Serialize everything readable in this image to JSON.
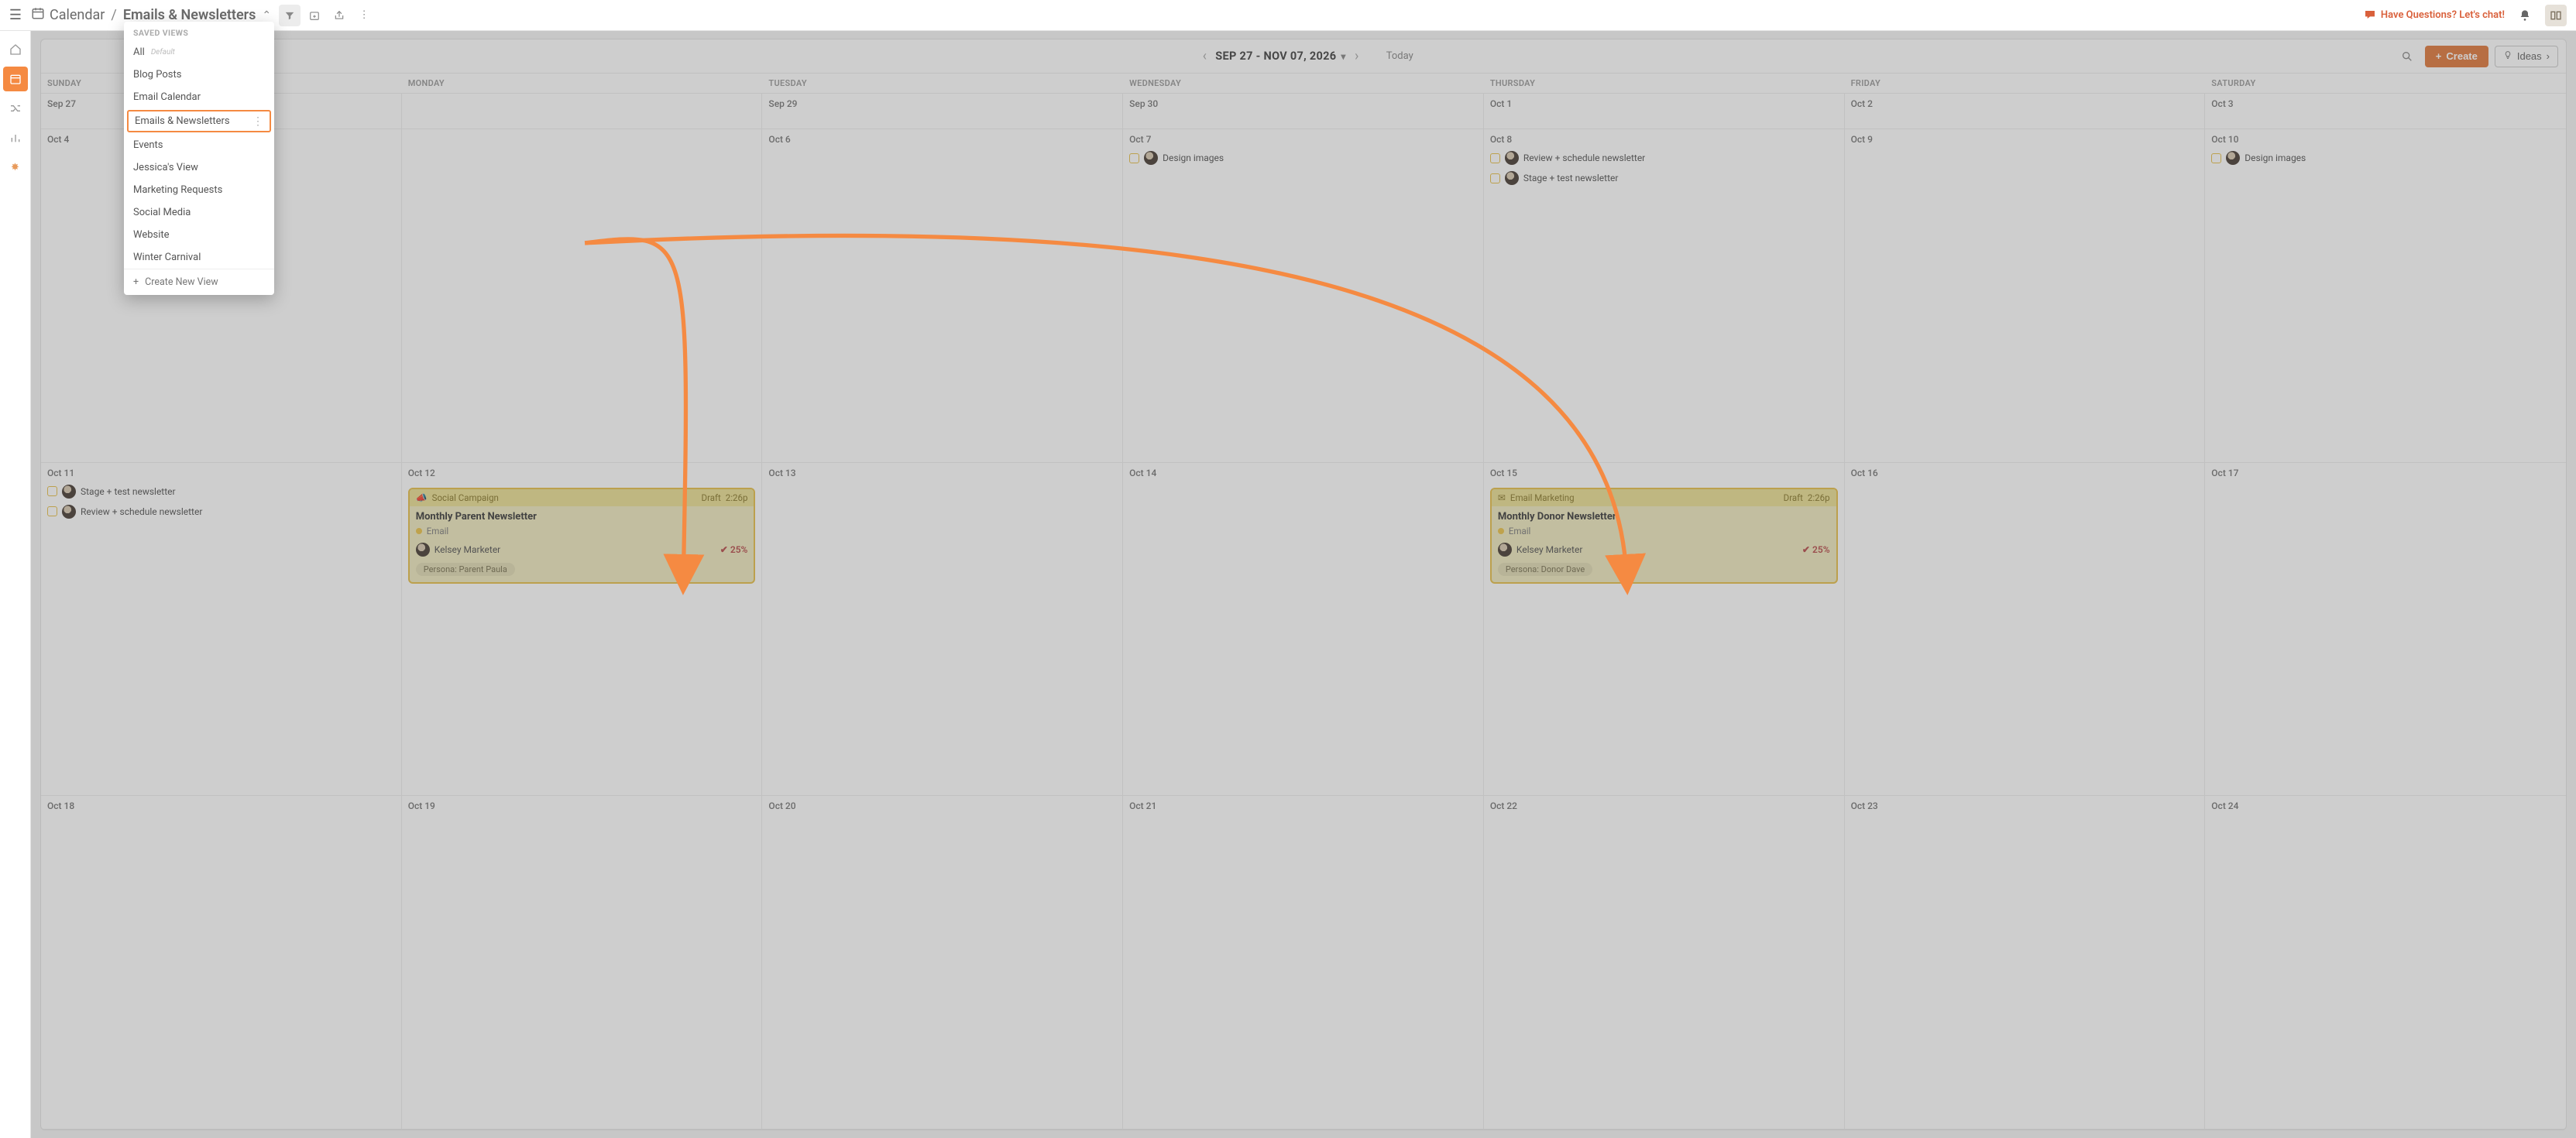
{
  "topbar": {
    "section": "Calendar",
    "view_name": "Emails & Newsletters",
    "chat": "Have Questions? Let's chat!"
  },
  "cal": {
    "range": "SEP 27 - NOV 07, 2026",
    "today": "Today",
    "create": "Create",
    "ideas": "Ideas"
  },
  "dow": [
    "SUNDAY",
    "MONDAY",
    "TUESDAY",
    "WEDNESDAY",
    "THURSDAY",
    "FRIDAY",
    "SATURDAY"
  ],
  "weeks": {
    "w0": [
      "Sep 27",
      "",
      "Sep 29",
      "Sep 30",
      "Oct 1",
      "Oct 2",
      "Oct 3"
    ],
    "w1": [
      "Oct 4",
      "",
      "Oct 6",
      "Oct 7",
      "Oct 8",
      "Oct 9",
      "Oct 10"
    ],
    "w2": [
      "Oct 11",
      "Oct 12",
      "Oct 13",
      "Oct 14",
      "Oct 15",
      "Oct 16",
      "Oct 17"
    ],
    "w3": [
      "Oct 18",
      "Oct 19",
      "Oct 20",
      "Oct 21",
      "Oct 22",
      "Oct 23",
      "Oct 24"
    ]
  },
  "tasks": {
    "design_images": "Design images",
    "review_schedule": "Review + schedule newsletter",
    "stage_test": "Stage + test newsletter"
  },
  "cards": {
    "parent": {
      "kind": "Social Campaign",
      "status": "Draft",
      "time": "2:26p",
      "title": "Monthly Parent Newsletter",
      "type": "Email",
      "owner": "Kelsey Marketer",
      "pct": "25%",
      "tag": "Persona: Parent Paula"
    },
    "donor": {
      "kind": "Email Marketing",
      "status": "Draft",
      "time": "2:26p",
      "title": "Monthly Donor Newsletter",
      "type": "Email",
      "owner": "Kelsey Marketer",
      "pct": "25%",
      "tag": "Persona: Donor Dave"
    }
  },
  "dropdown": {
    "label": "SAVED VIEWS",
    "items": {
      "all": "All",
      "all_default": "Default",
      "blog": "Blog Posts",
      "email_cal": "Email Calendar",
      "emails": "Emails & Newsletters",
      "events": "Events",
      "jessica": "Jessica's View",
      "marketing": "Marketing Requests",
      "social": "Social Media",
      "website": "Website",
      "winter": "Winter Carnival"
    },
    "create": "Create New View"
  }
}
